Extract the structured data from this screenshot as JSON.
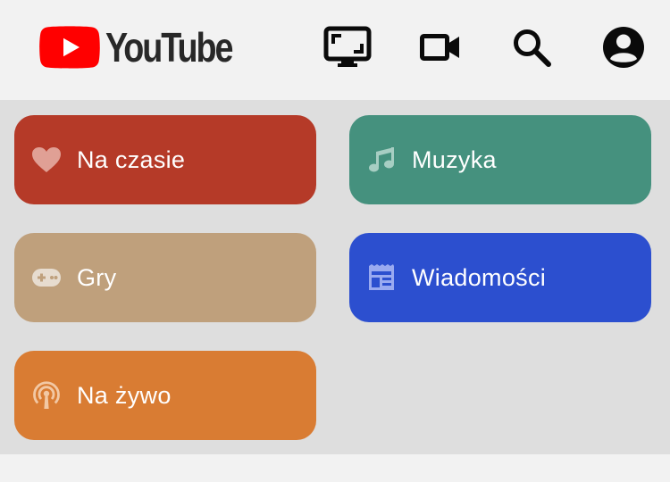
{
  "app": {
    "logo_text": "YouTube",
    "logo_color": "#ff0000"
  },
  "header": {
    "icons": [
      "cast-icon",
      "video-camera-icon",
      "search-icon",
      "account-icon"
    ]
  },
  "categories": [
    {
      "label": "Na czasie",
      "icon": "heart-icon",
      "color": "#b53a28"
    },
    {
      "label": "Muzyka",
      "icon": "music-note-icon",
      "color": "#45917e"
    },
    {
      "label": "Gry",
      "icon": "gamepad-icon",
      "color": "#bfa07c"
    },
    {
      "label": "Wiadomości",
      "icon": "newspaper-icon",
      "color": "#2c4fcf"
    },
    {
      "label": "Na żywo",
      "icon": "live-broadcast-icon",
      "color": "#d97c33"
    }
  ]
}
